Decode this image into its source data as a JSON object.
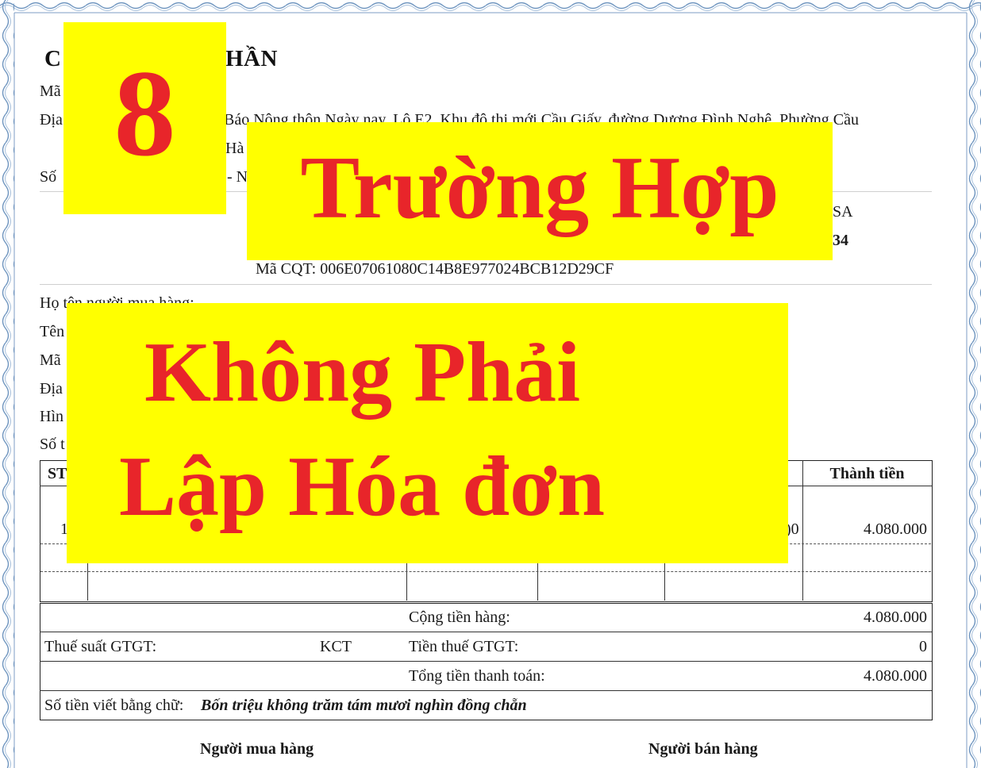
{
  "invoice": {
    "company_fragment_left": "C",
    "company_fragment_right": "HẦN",
    "tax_code_fragment": "Mã",
    "address_fragment_left": "Địa",
    "address_text": "Báo Nông thôn Ngày nay, Lô E2, Khu đô thị mới Cầu Giấy, đường Dương Đình Nghệ, Phường Cầu",
    "address_line2_fragment": "Hà",
    "phone_fragment_left": "Số",
    "phone_fragment_right": "- N",
    "serial_fragment": "SA",
    "number_fragment": "34",
    "cqt_code": "Mã CQT: 006E07061080C14B8E977024BCB12D29CF",
    "buyer_name_label": "Họ tên người mua hàng:",
    "buyer_company_fragment": "Tên",
    "buyer_tax_fragment": "Mã",
    "buyer_address_fragment": "Địa",
    "payment_fragment": "Hìn",
    "account_fragment": "Số t",
    "table": {
      "col_stt_fragment": "ST",
      "col_amount": "Thành tiền",
      "row1_stt_fragment": "1",
      "row1_price_fragment": ")0",
      "row1_amount": "4.080.000"
    },
    "totals": {
      "subtotal_label": "Cộng tiền hàng:",
      "subtotal_value": "4.080.000",
      "vat_rate_label": "Thuế suất GTGT:",
      "vat_rate_value": "KCT",
      "vat_amount_label": "Tiền thuế GTGT:",
      "vat_amount_value": "0",
      "total_label": "Tổng tiền thanh toán:",
      "total_value": "4.080.000",
      "in_words_label": "Số tiền viết bằng chữ:",
      "in_words_value": "Bốn triệu không trăm tám mươi nghìn đồng chẵn"
    },
    "signatures": {
      "buyer": "Người mua hàng",
      "seller": "Người bán hàng"
    }
  },
  "overlay": {
    "number": "8",
    "line1": "Trường Hợp",
    "line2": "Không Phải",
    "line3": "Lập Hóa đơn"
  },
  "colors": {
    "highlight": "#ffff00",
    "text_red": "#e8252a",
    "border_blue": "#5b87b5"
  }
}
